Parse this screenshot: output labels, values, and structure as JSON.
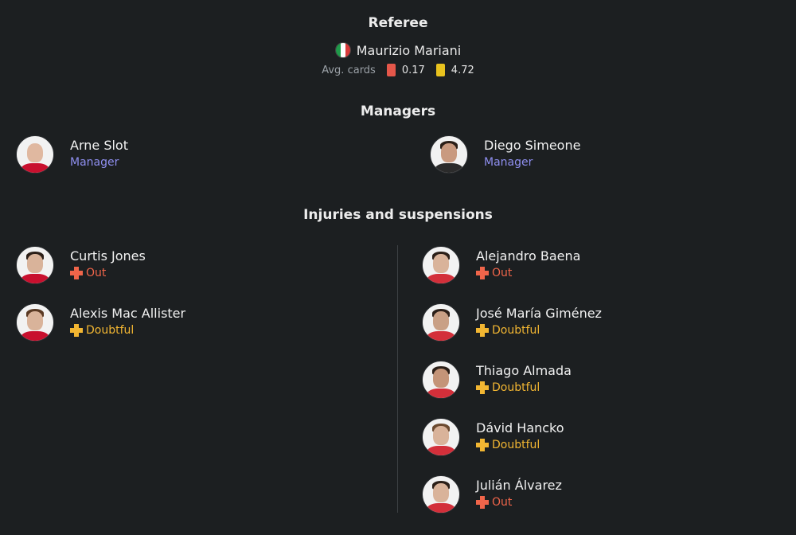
{
  "referee": {
    "title": "Referee",
    "name": "Maurizio Mariani",
    "flag_icon": "italy-flag-icon",
    "avg_cards_label": "Avg. cards",
    "red_avg": "0.17",
    "yellow_avg": "4.72",
    "red_color": "#e5574a",
    "yellow_color": "#e8c21e"
  },
  "managers": {
    "title": "Managers",
    "home": {
      "name": "Arne Slot",
      "role": "Manager"
    },
    "away": {
      "name": "Diego Simeone",
      "role": "Manager"
    }
  },
  "injuries": {
    "title": "Injuries and suspensions",
    "home": [
      {
        "name": "Curtis Jones",
        "status": "Out"
      },
      {
        "name": "Alexis Mac Allister",
        "status": "Doubtful"
      }
    ],
    "away": [
      {
        "name": "Alejandro Baena",
        "status": "Out"
      },
      {
        "name": "José María Giménez",
        "status": "Doubtful"
      },
      {
        "name": "Thiago Almada",
        "status": "Doubtful"
      },
      {
        "name": "Dávid Hancko",
        "status": "Doubtful"
      },
      {
        "name": "Julián Álvarez",
        "status": "Out"
      }
    ]
  },
  "colors": {
    "background": "#1c1f21",
    "manager_role": "#8f8ff0",
    "out": "#f0654a",
    "doubtful": "#f2b632",
    "home_kit": "#c8102e",
    "away_kit": "#d32f3a"
  }
}
